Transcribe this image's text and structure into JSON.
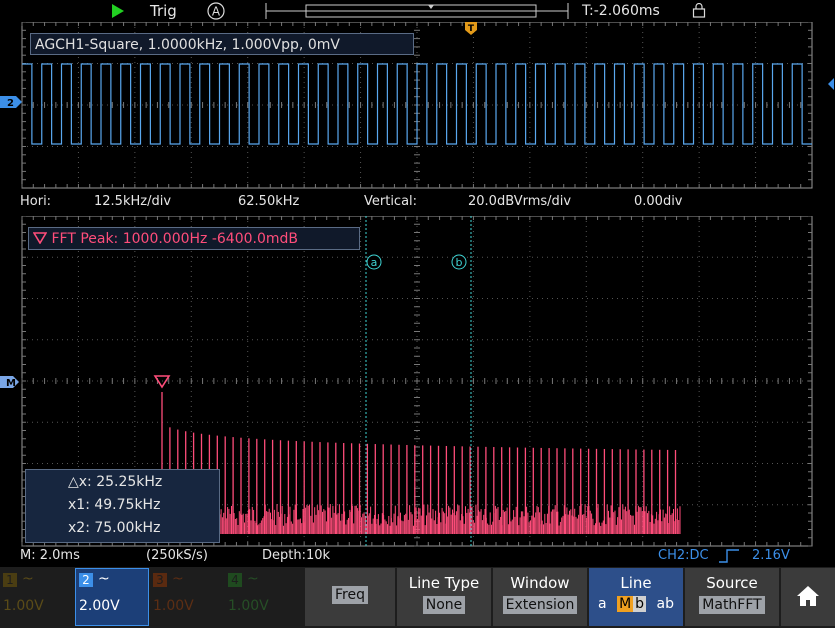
{
  "top_bar": {
    "trig_label": "Trig",
    "trig_mode_glyph": "A",
    "trigger_time": "T:-2.060ms",
    "trigger_marker": "T"
  },
  "main_window": {
    "channel_marker": "2",
    "info_label": "AGCH1-Square, 1.0000kHz, 1.000Vpp, 0mV"
  },
  "fft_info": {
    "hori_label": "Hori:",
    "hori_scale": "12.5kHz/div",
    "hori_center": "62.50kHz",
    "vertical_label": "Vertical:",
    "vertical_scale": "20.0dBVrms/div",
    "vertical_offset": "0.00div"
  },
  "fft_window": {
    "peak_label": "FFT Peak: 1000.000Hz  -6400.0mdB",
    "cursor_a": "a",
    "cursor_b": "b",
    "math_marker": "M",
    "cursor_readout": {
      "dx": "△x: 25.25kHz",
      "x1": "x1: 49.75kHz",
      "x2": "x2: 75.00kHz"
    }
  },
  "status_bar": {
    "timebase": "M: 2.0ms",
    "sample_rate": "(250kS/s)",
    "depth": "Depth:10k",
    "trigger_info": "CH2:DC",
    "trigger_level": "2.16V"
  },
  "channels": [
    {
      "num": "1",
      "coupling": "~",
      "scale": "1.00V",
      "color": "#c9a227",
      "active": false
    },
    {
      "num": "2",
      "coupling": "~",
      "scale": "2.00V",
      "color": "#3c8fe8",
      "active": true
    },
    {
      "num": "3",
      "coupling": "~",
      "scale": "1.00V",
      "color": "#c75a1e",
      "active": false
    },
    {
      "num": "4",
      "coupling": "~",
      "scale": "1.00V",
      "color": "#3aa03a",
      "active": false
    }
  ],
  "menu": {
    "freq_label": "Freq",
    "line_type_label": "Line Type",
    "line_type_value": "None",
    "window_label": "Window",
    "window_value": "Extension",
    "line_label": "Line",
    "line_options": [
      "a",
      "M",
      "b",
      "ab"
    ],
    "source_label": "Source",
    "source_value": "MathFFT",
    "home_icon": "home-icon"
  },
  "colors": {
    "ch2_trace": "#5aa8ef",
    "fft_trace": "#ff4d7a",
    "cursor": "#3fd4d4",
    "accent_blue": "#2d4f8a"
  }
}
